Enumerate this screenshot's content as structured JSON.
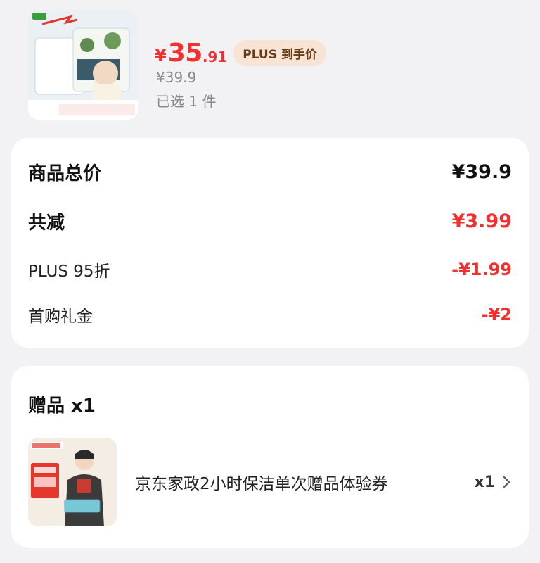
{
  "product": {
    "thumb_icon": "tissue-product-image",
    "currency": "¥",
    "price_int": "35",
    "price_dec": ".91",
    "plus_label": "PLUS 到手价",
    "original_price": "¥39.9",
    "selected_count": "已选 1 件"
  },
  "summary": {
    "rows": [
      {
        "label": "商品总价",
        "value": "¥39.9"
      },
      {
        "label": "共减",
        "value": "¥3.99"
      },
      {
        "label": "PLUS 95折",
        "value": "-¥1.99"
      },
      {
        "label": "首购礼金",
        "value": "-¥2"
      }
    ]
  },
  "gift": {
    "title": "赠品 x1",
    "thumb_icon": "cleaning-service-image",
    "name": "京东家政2小时保洁单次赠品体验券",
    "qty": "x1"
  },
  "colors": {
    "accent_red": "#f23030",
    "badge_bg": "#f7e4d4",
    "badge_text": "#6a3b14"
  }
}
